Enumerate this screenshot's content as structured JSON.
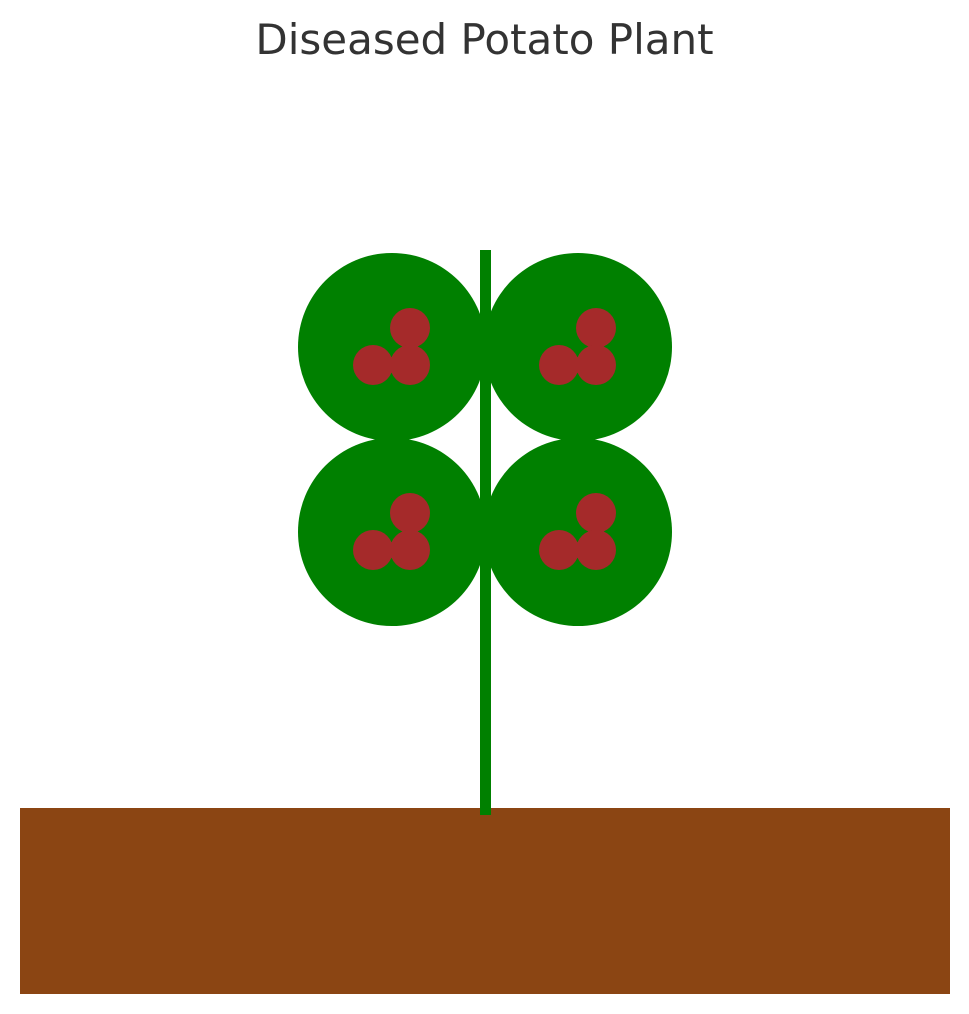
{
  "title": "Diseased Potato Plant",
  "colors": {
    "background": "#ffffff",
    "soil": "#8B4513",
    "stem": "#008000",
    "leaf": "#008000",
    "spot": "#A52A2A",
    "title": "#333333"
  },
  "plant": {
    "leaf_count": 4,
    "spots_per_leaf": 3
  }
}
